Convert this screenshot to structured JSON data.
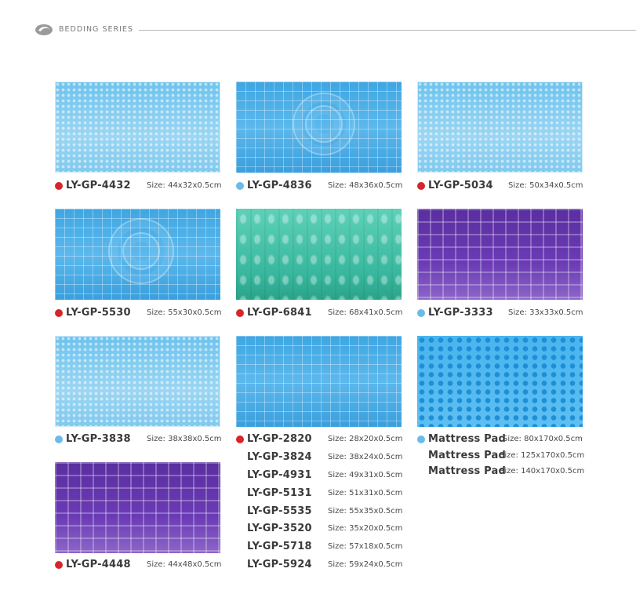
{
  "header": {
    "series_label": "BEDDING SERIES",
    "logo_icon": "swirl-logo-icon"
  },
  "colors": {
    "red_dot": "#d7262b",
    "blue_dot": "#6bbbe6",
    "rule": "#b5b5b5"
  },
  "size_prefix": "Size:",
  "items": [
    {
      "model": "LY-GP-4432",
      "size": "44x32x0.5cm",
      "dot": "red"
    },
    {
      "model": "LY-GP-4836",
      "size": "48x36x0.5cm",
      "dot": "blue"
    },
    {
      "model": "LY-GP-5034",
      "size": "50x34x0.5cm",
      "dot": "red"
    },
    {
      "model": "LY-GP-5530",
      "size": "55x30x0.5cm",
      "dot": "red"
    },
    {
      "model": "LY-GP-6841",
      "size": "68x41x0.5cm",
      "dot": "red"
    },
    {
      "model": "LY-GP-3333",
      "size": "33x33x0.5cm",
      "dot": "blue"
    },
    {
      "model": "LY-GP-3838",
      "size": "38x38x0.5cm",
      "dot": "blue"
    },
    {
      "model": "LY-GP-2820",
      "size": "28x20x0.5cm",
      "dot": "red"
    },
    {
      "model": "LY-GP-3824",
      "size": "38x24x0.5cm"
    },
    {
      "model": "LY-GP-4931",
      "size": "49x31x0.5cm"
    },
    {
      "model": "LY-GP-5131",
      "size": "51x31x0.5cm"
    },
    {
      "model": "LY-GP-5535",
      "size": "55x35x0.5cm"
    },
    {
      "model": "LY-GP-3520",
      "size": "35x20x0.5cm"
    },
    {
      "model": "LY-GP-5718",
      "size": "57x18x0.5cm"
    },
    {
      "model": "LY-GP-5924",
      "size": "59x24x0.5cm"
    },
    {
      "model": "Mattress Pad",
      "size": "80x170x0.5cm",
      "dot": "blue"
    },
    {
      "model": "Mattress Pad",
      "size": "125x170x0.5cm"
    },
    {
      "model": "Mattress Pad",
      "size": "140x170x0.5cm"
    },
    {
      "model": "LY-GP-4448",
      "size": "44x48x0.5cm",
      "dot": "red"
    }
  ]
}
